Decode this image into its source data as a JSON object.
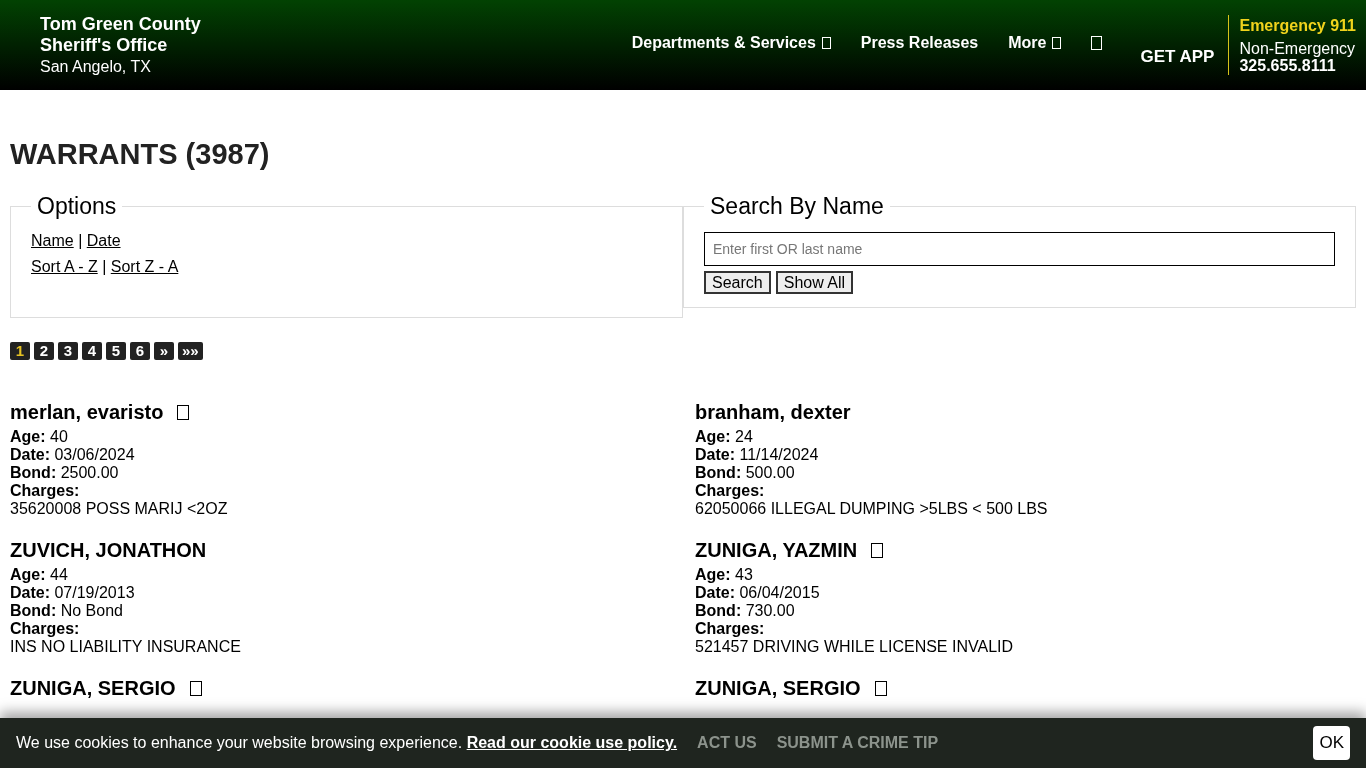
{
  "header": {
    "title_lines": [
      "Tom Green County",
      "Sheriff's Office"
    ],
    "location": "San Angelo, TX",
    "nav": [
      {
        "label": "Departments & Services",
        "icon": true
      },
      {
        "label": "Press Releases",
        "icon": false
      },
      {
        "label": "More",
        "icon": true
      }
    ],
    "get_app": "GET APP",
    "emergency": "Emergency 911",
    "non_emergency": "Non-Emergency",
    "phone": "325.655.8111"
  },
  "page_title": "WARRANTS (3987)",
  "options": {
    "legend": "Options",
    "rows": [
      [
        "Name",
        "Date"
      ],
      [
        "Sort A - Z",
        "Sort Z - A"
      ]
    ],
    "separator": "|"
  },
  "search": {
    "legend": "Search By Name",
    "placeholder": "Enter first OR last name",
    "buttons": [
      "Search",
      "Show All"
    ]
  },
  "pagination": [
    {
      "label": "1",
      "selected": true
    },
    {
      "label": "2",
      "selected": false
    },
    {
      "label": "3",
      "selected": false
    },
    {
      "label": "4",
      "selected": false
    },
    {
      "label": "5",
      "selected": false
    },
    {
      "label": "6",
      "selected": false
    },
    {
      "label": "»",
      "selected": false
    },
    {
      "label": "»»",
      "selected": false
    }
  ],
  "columns": [
    [
      {
        "name": "merlan, evaristo",
        "icon": true,
        "details": [
          [
            "Age:",
            "40"
          ],
          [
            "Date:",
            "03/06/2024"
          ],
          [
            "Bond:",
            "2500.00"
          ]
        ],
        "charges_label": "Charges:",
        "charges": "35620008 POSS MARIJ <2OZ"
      },
      {
        "name": "ZUVICH, JONATHON",
        "icon": false,
        "details": [
          [
            "Age:",
            "44"
          ],
          [
            "Date:",
            "07/19/2013"
          ],
          [
            "Bond:",
            "No Bond"
          ]
        ],
        "charges_label": "Charges:",
        "charges": "INS NO LIABILITY INSURANCE"
      },
      {
        "name": "ZUNIGA, SERGIO",
        "icon": true
      }
    ],
    [
      {
        "name": "branham, dexter",
        "icon": false,
        "details": [
          [
            "Age:",
            "24"
          ],
          [
            "Date:",
            "11/14/2024"
          ],
          [
            "Bond:",
            "500.00"
          ]
        ],
        "charges_label": "Charges:",
        "charges": "62050066 ILLEGAL DUMPING >5LBS < 500 LBS"
      },
      {
        "name": "ZUNIGA, YAZMIN",
        "icon": true,
        "details": [
          [
            "Age:",
            "43"
          ],
          [
            "Date:",
            "06/04/2015"
          ],
          [
            "Bond:",
            "730.00"
          ]
        ],
        "charges_label": "Charges:",
        "charges": "521457 DRIVING WHILE LICENSE INVALID"
      },
      {
        "name": "ZUNIGA, SERGIO",
        "icon": true
      }
    ]
  ],
  "footer_links": [
    "ACT US",
    "SUBMIT A CRIME TIP"
  ],
  "cookie": {
    "text": "We use cookies to enhance your website browsing experience.",
    "link": "Read our cookie use policy.",
    "button": "OK"
  }
}
